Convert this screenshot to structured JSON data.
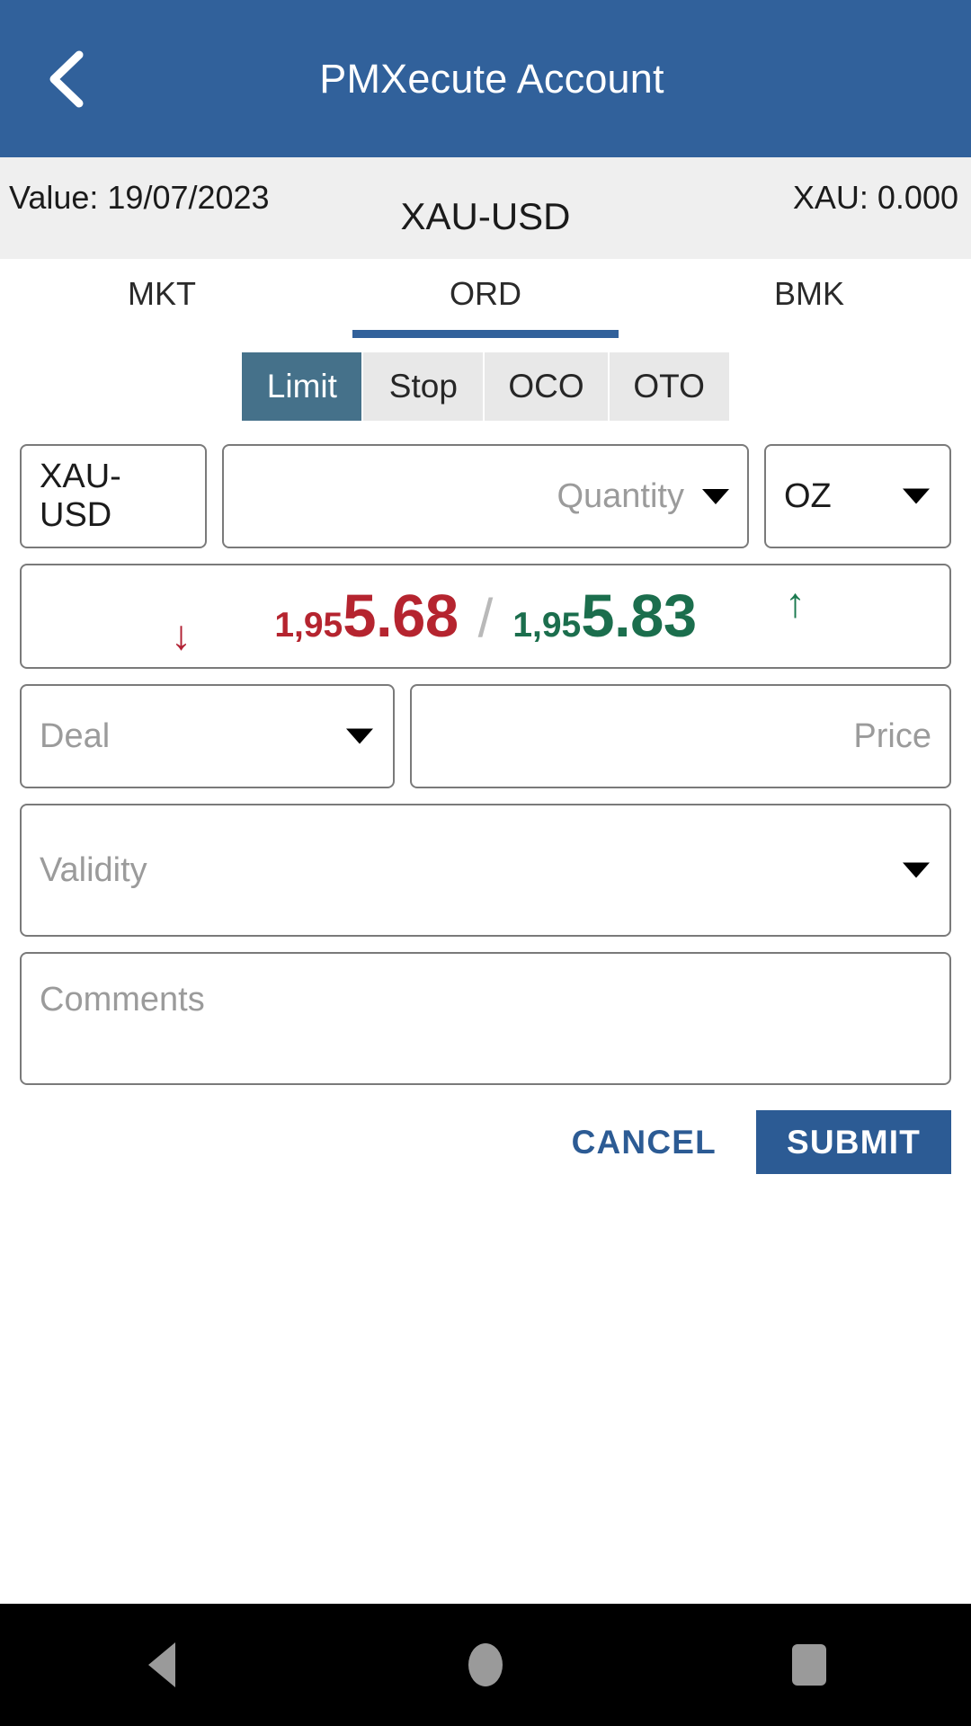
{
  "appbar": {
    "back_icon": "chevron-left-icon",
    "title": "PMXecute Account"
  },
  "infobar": {
    "value_date": "Value: 19/07/2023",
    "instrument": "XAU-USD",
    "balance": "XAU: 0.000"
  },
  "tabs": [
    {
      "label": "MKT",
      "active": false
    },
    {
      "label": "ORD",
      "active": true
    },
    {
      "label": "BMK",
      "active": false
    }
  ],
  "order_types": [
    {
      "label": "Limit",
      "active": true
    },
    {
      "label": "Stop",
      "active": false
    },
    {
      "label": "OCO",
      "active": false
    },
    {
      "label": "OTO",
      "active": false
    }
  ],
  "form": {
    "symbol_value": "XAU-USD",
    "quantity_placeholder": "Quantity",
    "unit_value": "OZ",
    "deal_placeholder": "Deal",
    "price_placeholder": "Price",
    "validity_placeholder": "Validity",
    "comments_placeholder": "Comments"
  },
  "quote": {
    "bid_lead": "1,95",
    "bid_main": "5.68",
    "separator": "/",
    "ask_lead": "1,95",
    "ask_main": "5.83",
    "bid_trend_icon": "arrow-down-icon",
    "bid_trend_glyph": "↓",
    "ask_trend_icon": "arrow-up-icon",
    "ask_trend_glyph": "↑",
    "bid_full": "1,955.68",
    "ask_full": "1,955.83"
  },
  "actions": {
    "cancel_label": "CANCEL",
    "submit_label": "SUBMIT"
  },
  "navbar": {
    "back_icon": "triangle-back-icon",
    "home_icon": "circle-home-icon",
    "recents_icon": "square-recents-icon"
  },
  "colors": {
    "appbar_blue": "#31619B",
    "accent_blue": "#2C5B94",
    "segment_active": "#45718A",
    "bid_red": "#B5242F",
    "ask_green": "#1B6E4D",
    "infobar_grey": "#EFEFEF"
  }
}
